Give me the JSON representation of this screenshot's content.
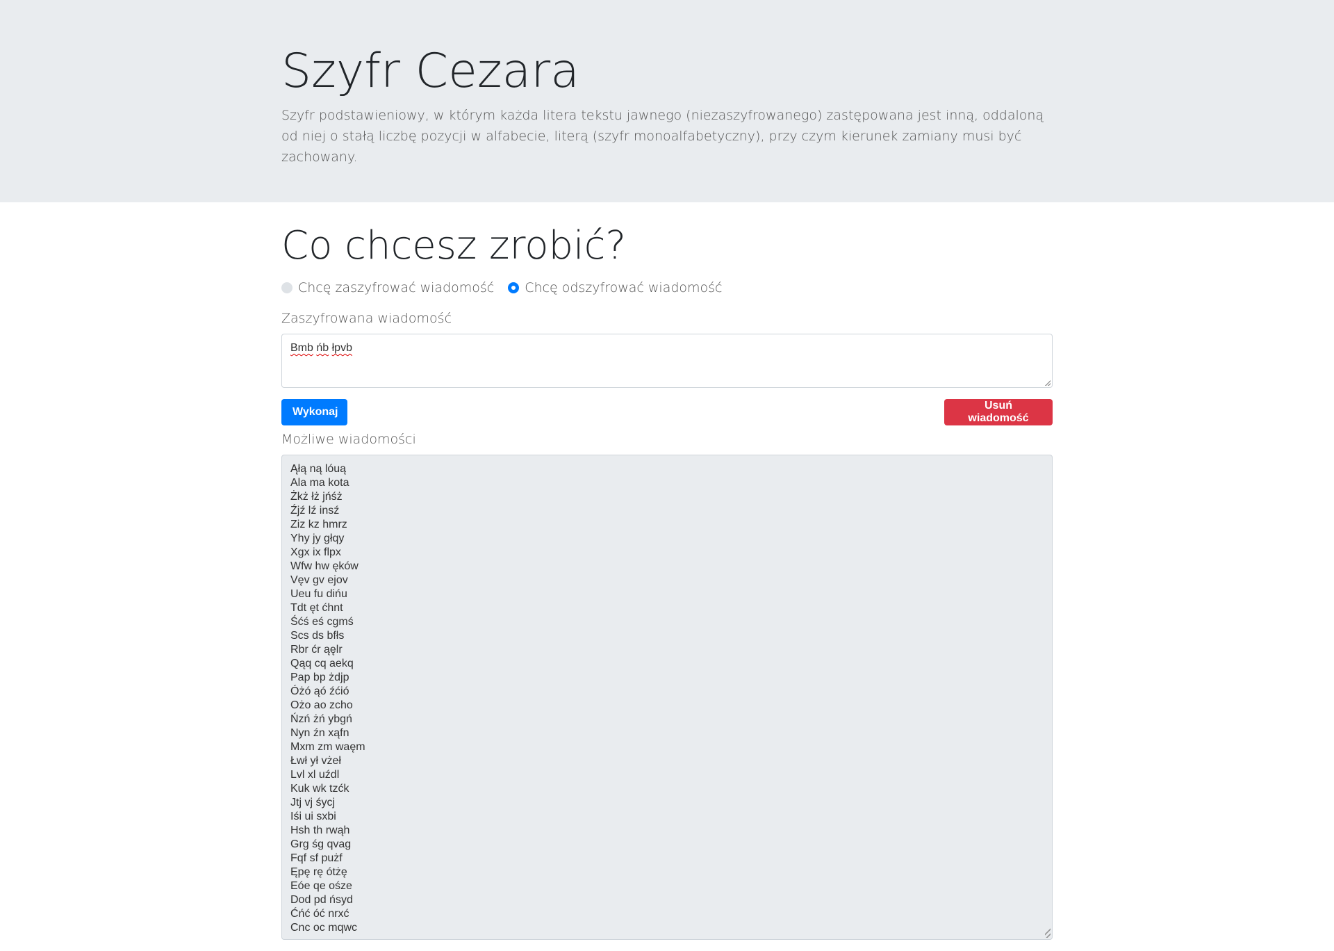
{
  "header": {
    "title": "Szyfr Cezara",
    "description": "Szyfr podstawieniowy, w którym każda litera tekstu jawnego (niezaszyfrowanego) zastępowana jest inną, oddaloną od niej o stałą liczbę pozycji w alfabecie, literą (szyfr monoalfabetyczny), przy czym kierunek zamiany musi być zachowany."
  },
  "main": {
    "heading": "Co chcesz zrobić?",
    "mode_options": [
      {
        "label": "Chcę zaszyfrować wiadomość",
        "selected": false
      },
      {
        "label": "Chcę odszyfrować wiadomość",
        "selected": true
      }
    ],
    "input_label": "Zaszyfrowana wiadomość",
    "input_words": [
      "Bmb",
      "ńb",
      "łpvb"
    ],
    "execute_label": "Wykonaj",
    "delete_label": "Usuń wiadomość",
    "output_label": "Możliwe wiadomości",
    "results": [
      "Ąłą ną lóuą",
      "Ala ma kota",
      "Żkż łż jńśż",
      "Źjź lź insź",
      "Ziz kz hmrz",
      "Yhy jy głqy",
      "Xgx ix flpx",
      "Wfw hw ęków",
      "Vęv gv ejov",
      "Ueu fu dińu",
      "Tdt ęt ćhnt",
      "Śćś eś cgmś",
      "Scs ds bfłs",
      "Rbr ćr ąęlr",
      "Qąq cq aekq",
      "Pap bp żdjp",
      "Óżó ąó źćió",
      "Ożo ao zcho",
      "Ńzń żń ybgń",
      "Nyn źn xąfn",
      "Mxm zm waęm",
      "Łwł ył vżeł",
      "Lvl xl uźdl",
      "Kuk wk tzćk",
      "Jtj vj śycj",
      "Iśi ui sxbi",
      "Hsh th rwąh",
      "Grg śg qvag",
      "Fqf sf pużf",
      "Ępę rę ótżę",
      "Eóe qe ośze",
      "Dod pd ńsyd",
      "Ćńć óć nrxć",
      "Cnc oc mqwc"
    ]
  },
  "colors": {
    "primary": "#007bff",
    "danger": "#dc3545",
    "jumbotron": "#e9ecef"
  }
}
